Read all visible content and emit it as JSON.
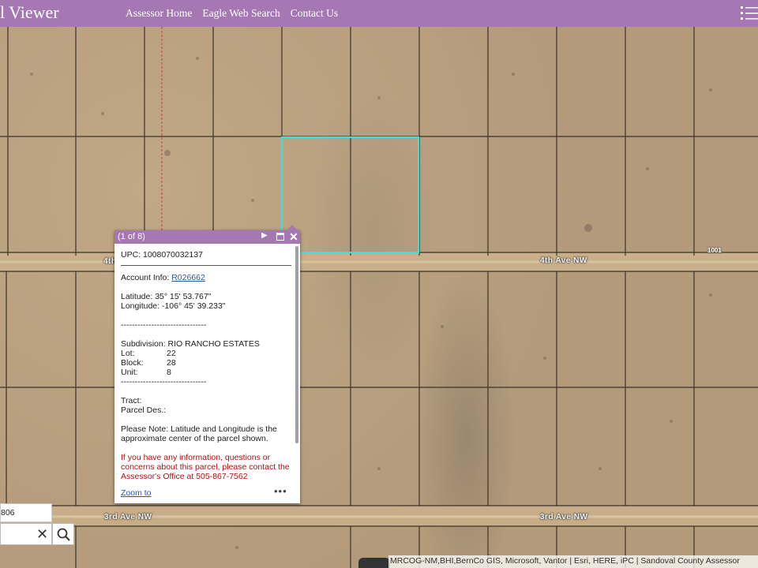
{
  "header": {
    "title": "l Viewer",
    "nav": [
      "Assessor Home",
      "Eagle Web Search",
      "Contact Us"
    ]
  },
  "map": {
    "roads": {
      "road_upper_left": "4th",
      "road_upper_right": "4th Ave NW",
      "road_lower_left": "3rd Ave NW",
      "road_lower_right": "3rd Ave NW"
    },
    "parcel_number": "1001"
  },
  "popup": {
    "count": "(1 of 8)",
    "upc": "UPC: 1008070032137",
    "account_label": "Account Info: ",
    "account_link": "R026662",
    "latitude": "Latitude: 35° 15' 53.767\"",
    "longitude": "Longitude: -106° 45' 39.233\"",
    "separator": "-------------------------------",
    "subdivision": "Subdivision: RIO RANCHO ESTATES",
    "lot_label": "Lot:",
    "lot_value": "22",
    "block_label": "Block:",
    "block_value": "28",
    "unit_label": "Unit:",
    "unit_value": "8",
    "tract": "Tract:",
    "parcel_des": "Parcel Des.:",
    "note": "Please Note: Latitude and Longitude is the approximate center of the parcel shown.",
    "contact": "If you have any information, questions or concerns about this parcel, please contact the Assessor's Office at 505-867-7562",
    "zoom_to": "Zoom to",
    "more": "•••"
  },
  "search": {
    "value": "806"
  },
  "attribution": "MRCOG-NM,BHI,BernCo GIS, Microsoft, Vantor | Esri, HERE, iPC | Sandoval County Assessor",
  "colors": {
    "header": "#a577b3",
    "selection": "#3ee0dc",
    "link": "#2c5a9c",
    "warning": "#b01010"
  }
}
